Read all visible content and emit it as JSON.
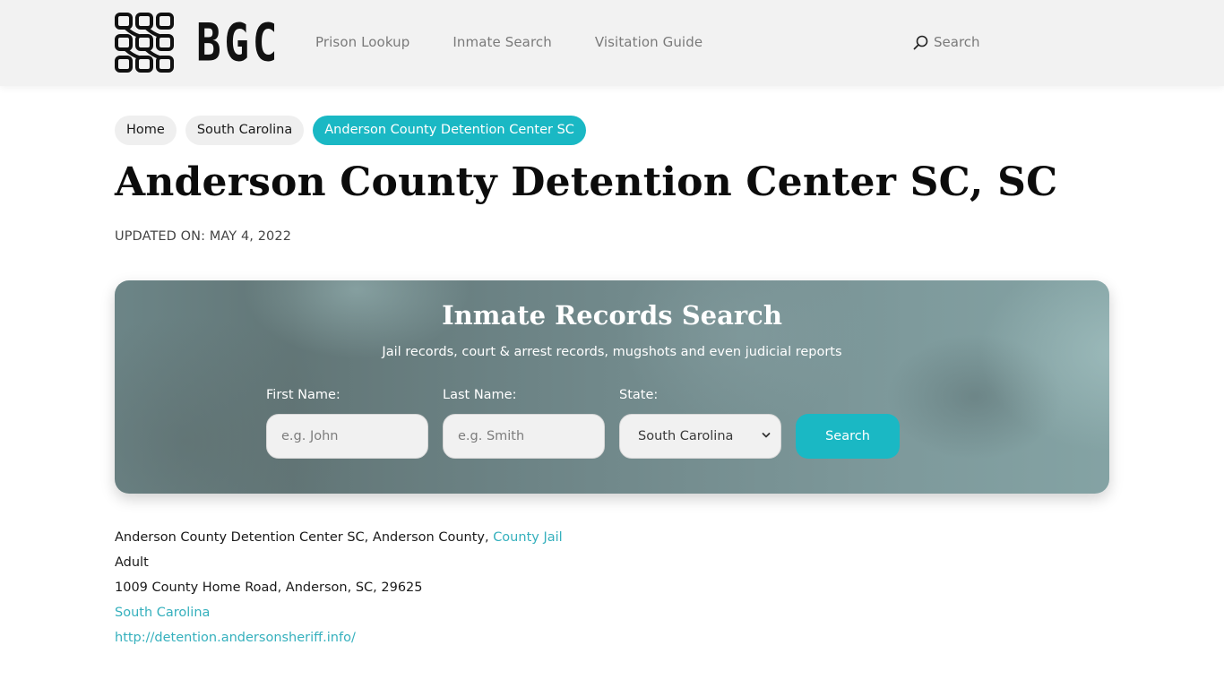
{
  "header": {
    "logo_text": "BGC",
    "nav": [
      {
        "label": "Prison Lookup"
      },
      {
        "label": "Inmate Search"
      },
      {
        "label": "Visitation Guide"
      }
    ],
    "search_label": "Search",
    "search_icon": "search-icon"
  },
  "breadcrumb": [
    {
      "label": "Home",
      "active": false
    },
    {
      "label": "South Carolina",
      "active": false
    },
    {
      "label": "Anderson County Detention Center SC",
      "active": true
    }
  ],
  "page": {
    "title": "Anderson County Detention Center SC, SC",
    "updated": "UPDATED ON: MAY 4, 2022"
  },
  "search_panel": {
    "title": "Inmate Records Search",
    "subtitle": "Jail records, court & arrest records, mugshots and even judicial reports",
    "first_name": {
      "label": "First Name:",
      "placeholder": "e.g. John",
      "value": ""
    },
    "last_name": {
      "label": "Last Name:",
      "placeholder": "e.g. Smith",
      "value": ""
    },
    "state": {
      "label": "State:",
      "selected": "South Carolina"
    },
    "button_label": "Search"
  },
  "details": {
    "facility_line": "Anderson County Detention Center SC, Anderson County, ",
    "facility_type_link": "County Jail",
    "population": "Adult",
    "address": "1009 County Home Road, Anderson, SC, 29625",
    "state_link": "South Carolina",
    "website_link": "http://detention.andersonsheriff.info/"
  },
  "colors": {
    "accent": "#1ab8c4",
    "link": "#35b0bd",
    "header_bg": "#f2f2f2"
  }
}
